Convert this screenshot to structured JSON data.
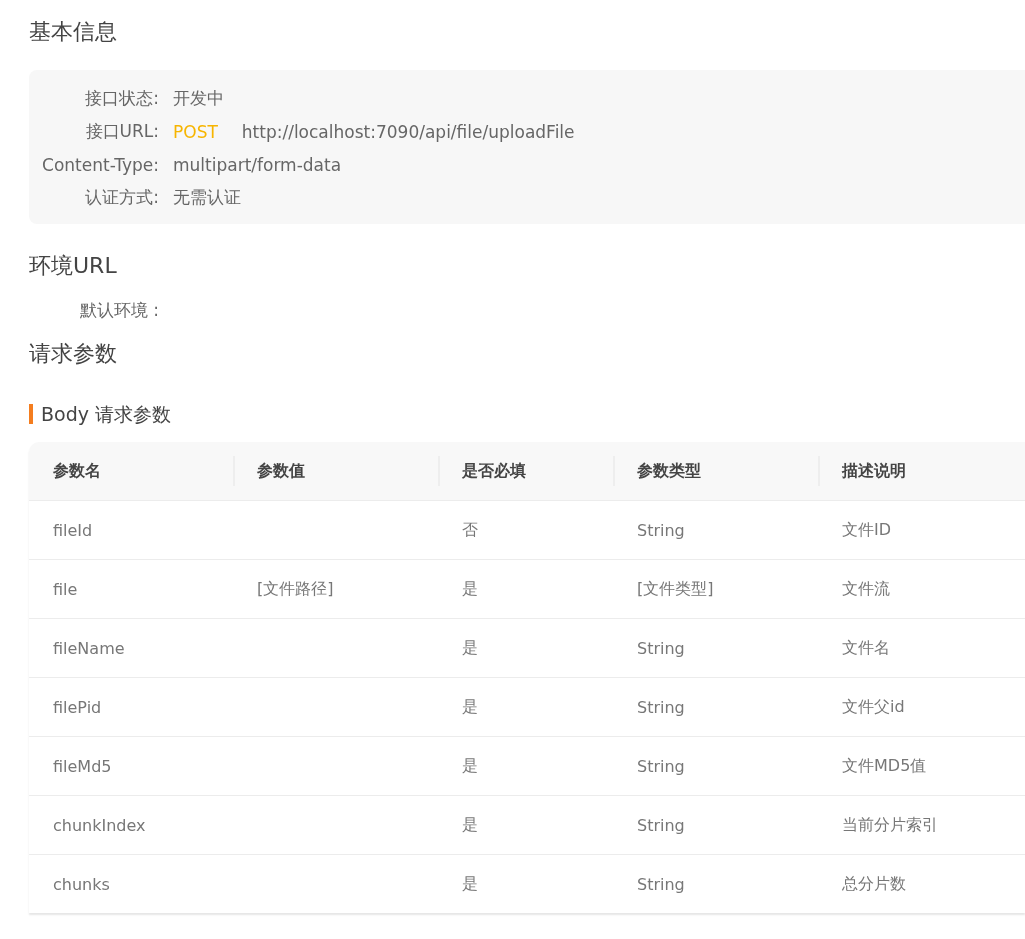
{
  "basic_info": {
    "title": "基本信息",
    "fields": [
      {
        "label": "接口状态:",
        "value": "开发中"
      },
      {
        "label": "接口URL:",
        "method": "POST",
        "value": "http://localhost:7090/api/file/uploadFile"
      },
      {
        "label": "Content-Type:",
        "value": "multipart/form-data"
      },
      {
        "label": "认证方式:",
        "value": "无需认证"
      }
    ]
  },
  "environment": {
    "title": "环境URL",
    "label": "默认环境 :"
  },
  "request_params": {
    "title": "请求参数",
    "subtitle": "Body 请求参数",
    "table": {
      "columns": [
        "参数名",
        "参数值",
        "是否必填",
        "参数类型",
        "描述说明"
      ],
      "rows": [
        {
          "name": "fileId",
          "required": "否",
          "type": "String",
          "description": "文件ID"
        },
        {
          "name": "file",
          "value": "[文件路径]",
          "required": "是",
          "type": "[文件类型]",
          "description": "文件流"
        },
        {
          "name": "fileName",
          "required": "是",
          "type": "String",
          "description": "文件名"
        },
        {
          "name": "filePid",
          "required": "是",
          "type": "String",
          "description": "文件父id"
        },
        {
          "name": "fileMd5",
          "required": "是",
          "type": "String",
          "description": "文件MD5值"
        },
        {
          "name": "chunkIndex",
          "required": "是",
          "type": "String",
          "description": "当前分片索引"
        },
        {
          "name": "chunks",
          "required": "是",
          "type": "String",
          "description": "总分片数"
        }
      ]
    }
  }
}
